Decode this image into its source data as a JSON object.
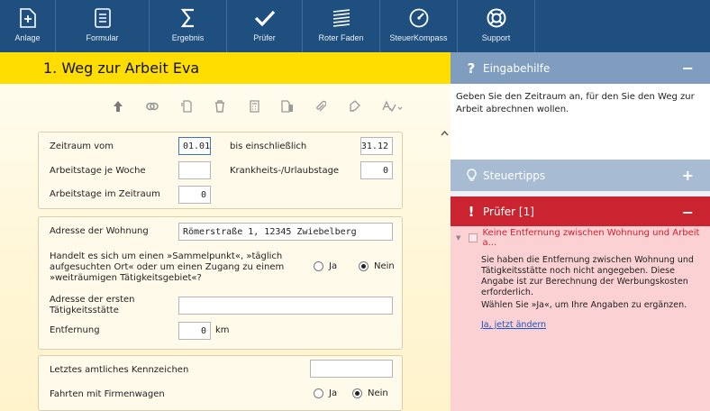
{
  "toolbar": [
    {
      "label": "Anlage",
      "icon": "add-document-icon"
    },
    {
      "label": "Formular",
      "icon": "form-icon"
    },
    {
      "label": "Ergebnis",
      "icon": "sigma-icon"
    },
    {
      "label": "Prüfer",
      "icon": "checkmark-icon"
    },
    {
      "label": "Roter Faden",
      "icon": "thread-icon"
    },
    {
      "label": "SteuerKompass",
      "icon": "compass-icon"
    },
    {
      "label": "Support",
      "icon": "lifebuoy-icon"
    }
  ],
  "page_title": "1. Weg zur Arbeit Eva",
  "form": {
    "zeitraum_vom_label": "Zeitraum vom",
    "zeitraum_vom_value": "01.01",
    "bis_label": "bis einschließlich",
    "bis_value": "31.12",
    "arbeitstage_woche_label": "Arbeitstage je Woche",
    "arbeitstage_woche_value": "",
    "krankheit_label": "Krankheits-/Urlaubstage",
    "krankheit_value": "0",
    "arbeitstage_zeitraum_label": "Arbeitstage im Zeitraum",
    "arbeitstage_zeitraum_value": "0",
    "adresse_label": "Adresse der Wohnung",
    "adresse_value": "Römerstraße 1, 12345 Zwiebelberg",
    "sammelpunkt_question": "Handelt es sich um einen »Sammelpunkt«, »täglich aufgesuchten Ort« oder um einen Zugang zu einem »weiträumigen Tätigkeitsgebiet«?",
    "ja": "Ja",
    "nein": "Nein",
    "taetigkeit_label": "Adresse der ersten Tätigkeitsstätte",
    "taetigkeit_value": "",
    "entfernung_label": "Entfernung",
    "entfernung_value": "0",
    "entfernung_unit": "km",
    "kennzeichen_label": "Letztes amtliches Kennzeichen",
    "kennzeichen_value": "",
    "firmenwagen_label": "Fahrten mit Firmenwagen",
    "sammelpunkt_selected": "Nein",
    "firmenwagen_selected": "Nein"
  },
  "sidebar": {
    "eingabehilfe": {
      "title": "Eingabehilfe",
      "toggle": "−",
      "text": "Geben Sie den Zeitraum an, für den Sie den Weg zur Arbeit abrechnen wollen."
    },
    "steuertipps": {
      "title": "Steuertipps",
      "toggle": "+"
    },
    "pruefer": {
      "title": "Prüfer [1]",
      "toggle": "−",
      "message_title": "Keine Entfernung zwischen Wohnung und Arbeit a...",
      "message_text": "Sie haben die Entfernung zwischen Wohnung und Tätigkeitsstätte noch nicht angegeben. Diese Angabe ist zur Berechnung der Werbungskosten erforderlich.",
      "message_hint": "Wählen Sie »Ja«, um Ihre Angaben zu ergänzen.",
      "link": "Ja, jetzt ändern"
    }
  },
  "colors": {
    "toolbar_bg": "#1e4f7f",
    "title_bar": "#ffdd00",
    "eingabehilfe_head": "#7f9dbf",
    "steuertipps_head": "#a7bbd2",
    "pruefer_head": "#c9242f",
    "pruefer_body": "#fbd1d4"
  }
}
